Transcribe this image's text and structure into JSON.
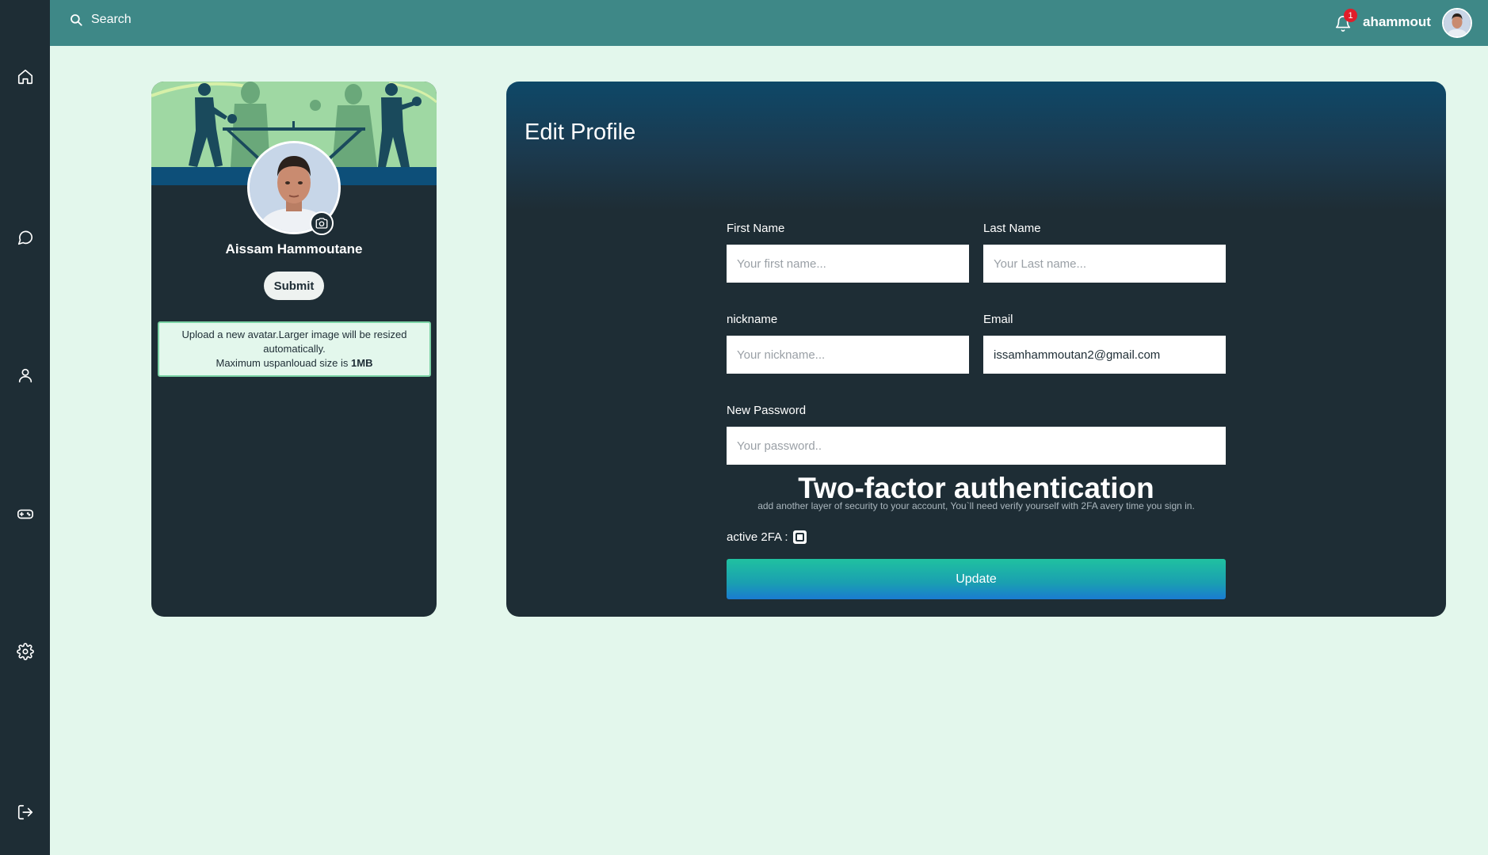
{
  "topbar": {
    "search_label": "Search",
    "notification_count": "1",
    "username": "ahammout"
  },
  "sidebar": {
    "items": [
      {
        "icon": "home-icon"
      },
      {
        "icon": "chat-icon"
      },
      {
        "icon": "user-icon"
      },
      {
        "icon": "gamepad-icon"
      },
      {
        "icon": "gear-icon"
      },
      {
        "icon": "logout-icon"
      }
    ]
  },
  "profile_card": {
    "full_name": "Aissam Hammoutane",
    "submit_label": "Submit",
    "note_line1": "Upload a new avatar.Larger image will be resized automatically.",
    "note_line2_prefix": "Maximum uspanlouad size is ",
    "note_max_size": "1MB"
  },
  "edit_profile": {
    "title": "Edit Profile",
    "first_name": {
      "label": "First Name",
      "placeholder": "Your first name...",
      "value": ""
    },
    "last_name": {
      "label": "Last Name",
      "placeholder": "Your Last name...",
      "value": ""
    },
    "nickname": {
      "label": "nickname",
      "placeholder": "Your nickname...",
      "value": ""
    },
    "email": {
      "label": "Email",
      "placeholder": "",
      "value": "issamhammoutan2@gmail.com"
    },
    "password": {
      "label": "New Password",
      "placeholder": "Your password..",
      "value": ""
    },
    "twofa_title": "Two-factor authentication",
    "twofa_desc": "add another layer of security to your account, You`ll need verify yourself with 2FA avery time you sign in.",
    "active_2fa_label": "active 2FA :",
    "update_label": "Update"
  },
  "colors": {
    "sidebar_bg": "#1e2d35",
    "topbar_bg": "#3e8887",
    "page_bg": "#e3f7ec",
    "badge": "#e11d2a",
    "update_gradient_top": "#20c1a0",
    "update_gradient_bottom": "#1a7bd1"
  }
}
